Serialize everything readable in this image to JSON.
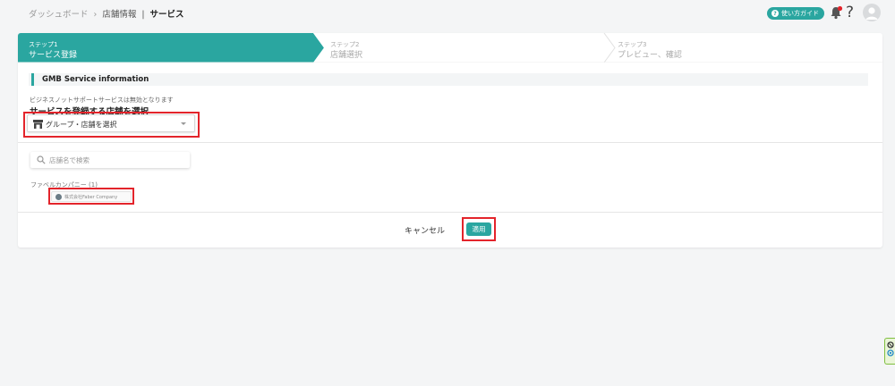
{
  "header": {
    "breadcrumb": [
      "ダッシュボード",
      "店舗情報",
      "サービス"
    ],
    "breadcrumb_sep": "›",
    "guide_label": "使い方ガイド",
    "help_label": "?"
  },
  "steps": [
    {
      "label": "ステップ1",
      "title": "サービス登録",
      "active": true
    },
    {
      "label": "ステップ2",
      "title": "店舗選択",
      "active": false
    },
    {
      "label": "ステップ3",
      "title": "プレビュー、確認",
      "active": false
    }
  ],
  "section": {
    "title": "GMB Service information",
    "notice": "ビジネスノットサポートサービスは無効となります",
    "select_heading": "サービスを登録する店舗を選択",
    "select_value": "グループ・店舗を選択"
  },
  "search": {
    "placeholder": "店舗名で検索"
  },
  "group": {
    "label": "ファベルカンパニー (1)",
    "stores": [
      "株式会社Faber Company"
    ]
  },
  "footer": {
    "cancel_label": "キャンセル",
    "apply_label": "適用"
  },
  "colors": {
    "accent": "#2aa6a0",
    "highlight": "#e3242b"
  }
}
